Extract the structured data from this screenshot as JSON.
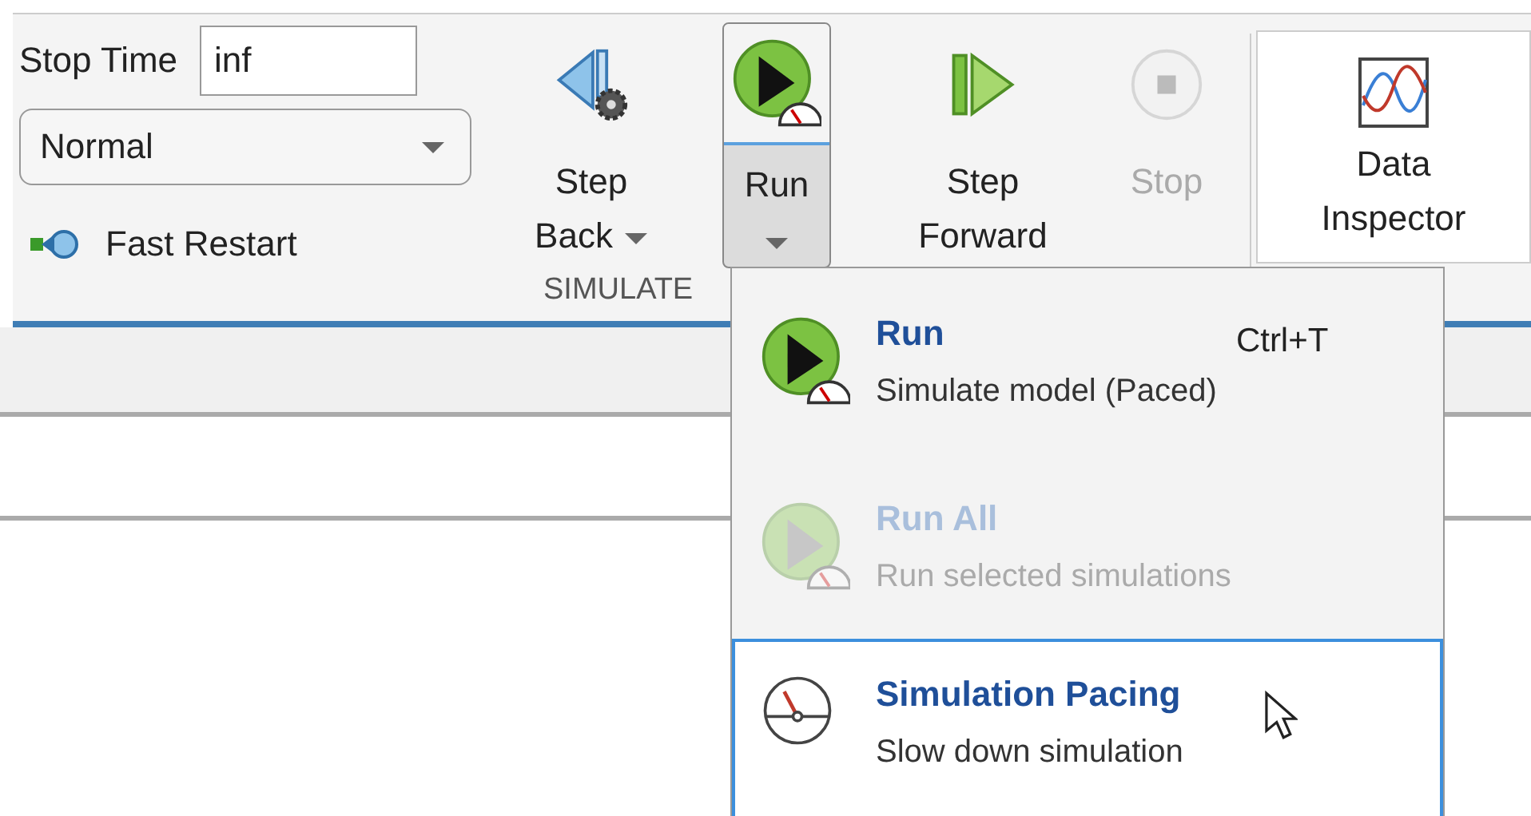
{
  "toolstrip": {
    "stop_time": {
      "label": "Stop Time",
      "value": "inf"
    },
    "mode": {
      "value": "Normal"
    },
    "fast_restart": {
      "label": "Fast Restart"
    },
    "buttons": [
      {
        "kind": "step_back",
        "label": "Step Back",
        "has_menu": true,
        "disabled": false,
        "selected": false
      },
      {
        "kind": "run",
        "label": "Run",
        "has_menu": true,
        "disabled": false,
        "selected": true
      },
      {
        "kind": "step_forward",
        "label": "Step Forward",
        "has_menu": false,
        "disabled": false,
        "selected": false
      },
      {
        "kind": "stop",
        "label": "Stop",
        "has_menu": false,
        "disabled": true,
        "selected": false
      }
    ],
    "section_label": "SIMULATE",
    "data_inspector": {
      "label": "Data Inspector"
    }
  },
  "run_menu": {
    "items": [
      {
        "kind": "run",
        "title": "Run",
        "description": "Simulate model (Paced)",
        "shortcut": "Ctrl+T",
        "disabled": false,
        "selected": false
      },
      {
        "kind": "run",
        "title": "Run All",
        "description": "Run selected simulations",
        "disabled": true,
        "selected": false
      },
      {
        "kind": "pacing",
        "title": "Simulation Pacing",
        "description": "Slow down simulation",
        "disabled": false,
        "selected": true
      }
    ]
  }
}
